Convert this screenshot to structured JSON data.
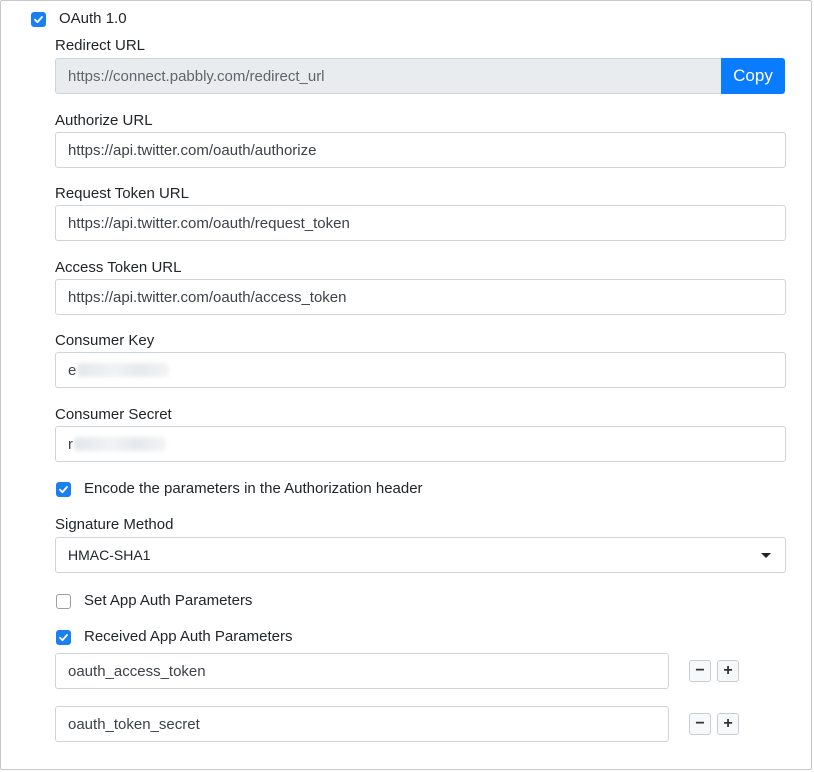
{
  "oauth_section": {
    "checkbox_label": "OAuth 1.0",
    "checked": true
  },
  "redirect_url": {
    "label": "Redirect URL",
    "value": "https://connect.pabbly.com/redirect_url",
    "copy_label": "Copy"
  },
  "authorize_url": {
    "label": "Authorize URL",
    "value": "https://api.twitter.com/oauth/authorize"
  },
  "request_token_url": {
    "label": "Request Token URL",
    "value": "https://api.twitter.com/oauth/request_token"
  },
  "access_token_url": {
    "label": "Access Token URL",
    "value": "https://api.twitter.com/oauth/access_token"
  },
  "consumer_key": {
    "label": "Consumer Key",
    "visible_prefix": "e"
  },
  "consumer_secret": {
    "label": "Consumer Secret",
    "visible_prefix": "r"
  },
  "encode_params": {
    "label": "Encode the parameters in the Authorization header",
    "checked": true
  },
  "signature_method": {
    "label": "Signature Method",
    "selected": "HMAC-SHA1"
  },
  "set_app_auth": {
    "label": "Set App Auth Parameters",
    "checked": false
  },
  "received_app_auth": {
    "label": "Received App Auth Parameters",
    "checked": true,
    "params": [
      {
        "value": "oauth_access_token",
        "minus": "−",
        "plus": "+"
      },
      {
        "value": "oauth_token_secret",
        "minus": "−",
        "plus": "+"
      }
    ]
  },
  "icons": {
    "check": "checkmark-icon",
    "caret": "caret-down-icon",
    "minus": "minus-icon",
    "plus": "plus-icon"
  },
  "colors": {
    "accent": "#0a7cff",
    "checkbox": "#1a7ff0",
    "readonly_bg": "#e9ecef",
    "border": "#ced4da"
  }
}
